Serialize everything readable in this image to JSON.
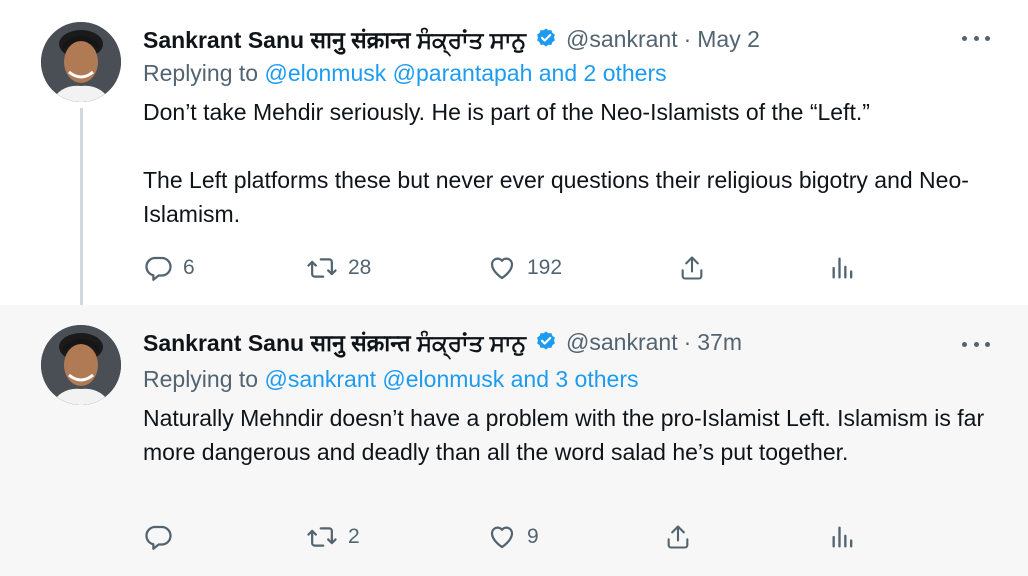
{
  "tweets": [
    {
      "name": "Sankrant Sanu सानु संक्रान्त ਸੰਕ੍ਰਾਂਤ ਸਾਨੁ",
      "handle": "@sankrant",
      "time": "May 2",
      "replying_prefix": "Replying to",
      "replying_mentions": "@elonmusk @parantapah",
      "replying_and": "and 2 others",
      "paragraphs": [
        "Don’t take Mehdir seriously. He is part of the Neo-Islamists of the “Left.”",
        "The Left platforms these but never ever questions their religious bigotry and Neo-Islamism."
      ],
      "replies": "6",
      "retweets": "28",
      "likes": "192"
    },
    {
      "name": "Sankrant Sanu सानु संक्रान्त ਸੰਕ੍ਰਾਂਤ ਸਾਨੁ",
      "handle": "@sankrant",
      "time": "37m",
      "replying_prefix": "Replying to",
      "replying_mentions": "@sankrant @elonmusk",
      "replying_and": "and 3 others",
      "paragraphs": [
        "Naturally Mehndir doesn’t have a problem with the pro-Islamist Left. Islamism is far more dangerous and deadly than all the word salad he’s put together."
      ],
      "replies": "",
      "retweets": "2",
      "likes": "9"
    }
  ],
  "icons": {
    "reply": "reply-icon",
    "retweet": "retweet-icon",
    "like": "like-icon",
    "share": "share-icon",
    "analytics": "analytics-icon",
    "verified": "verified-badge-icon",
    "more": "more-options-icon"
  },
  "colors": {
    "link": "#1d9bf0",
    "secondary_text": "#536471",
    "verified": "#1d9bf0",
    "highlight_background": "#f7f7f7"
  }
}
